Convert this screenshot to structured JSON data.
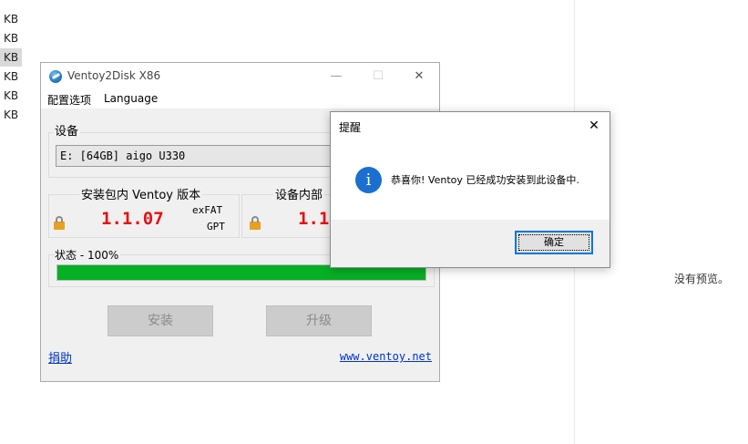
{
  "background": {
    "size_rows": [
      "KB",
      "KB",
      "KB",
      "KB",
      "KB",
      "KB"
    ],
    "selected_row_index": 2,
    "preview_text": "没有预览。"
  },
  "main_window": {
    "title": "Ventoy2Disk  X86",
    "minimize_glyph": "—",
    "maximize_glyph": "☐",
    "close_glyph": "✕",
    "menu": {
      "config_label": "配置选项",
      "language_label": "Language"
    },
    "device": {
      "group_label": "设备",
      "selected_value": "E: [64GB] aigo U330"
    },
    "package_version": {
      "label": "安装包内 Ventoy 版本",
      "version": "1.1.07",
      "partition_style": "exFAT",
      "partition_table": "GPT"
    },
    "device_version": {
      "label": "设备内部",
      "version": "1.1"
    },
    "status": {
      "label": "状态 - 100%",
      "progress": 1.0
    },
    "install_label": "安装",
    "upgrade_label": "升级",
    "donate_label": "捐助",
    "website_label": "www.ventoy.net"
  },
  "dialog": {
    "title": "提醒",
    "close_glyph": "✕",
    "icon_glyph": "i",
    "message": "恭喜你! Ventoy 已经成功安装到此设备中.",
    "ok_label": "确定"
  },
  "colors": {
    "progress_fill": "#06b025",
    "version_red": "#e81010",
    "link_blue": "#0033cc",
    "info_blue": "#1a6fd0",
    "focus_border": "#0078d7"
  }
}
